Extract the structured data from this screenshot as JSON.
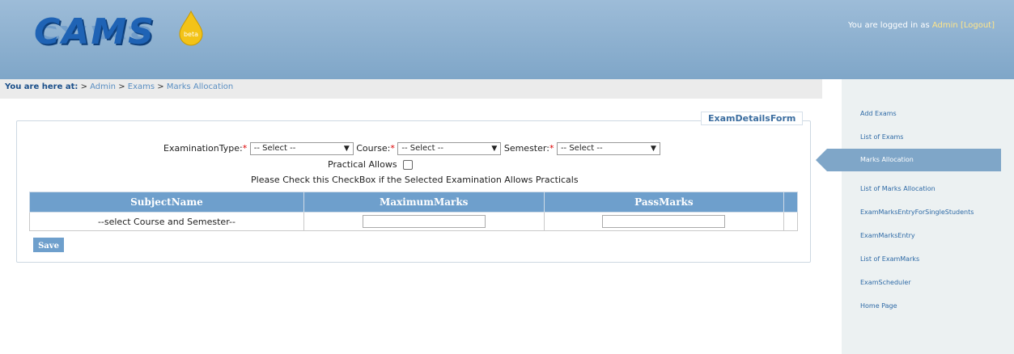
{
  "header": {
    "logo_text": "CAMS",
    "logo_badge": "beta",
    "login_prefix": "You are logged in as",
    "user": "Admin",
    "logout": "[Logout]"
  },
  "breadcrumb": {
    "lead": "You are here at:",
    "items": [
      "Admin",
      "Exams",
      "Marks Allocation"
    ]
  },
  "sidebar": {
    "items": [
      "Add Exams",
      "List of Exams",
      "Marks Allocation",
      "List of Marks Allocation",
      "ExamMarksEntryForSingleStudents",
      "ExamMarksEntry",
      "List of ExamMarks",
      "ExamScheduler",
      "Home Page"
    ],
    "active": "Marks Allocation"
  },
  "form": {
    "legend": "ExamDetailsForm",
    "exam_type_label": "ExaminationType:",
    "course_label": "Course:",
    "semester_label": "Semester:",
    "required_mark": "*",
    "select_placeholder": "-- Select --",
    "practical_label": "Practical Allows",
    "practical_note": "Please Check this CheckBox if the Selected Examination Allows Practicals",
    "table_headers": [
      "SubjectName",
      "MaximumMarks",
      "PassMarks"
    ],
    "empty_row_text": "--select Course and Semester--",
    "save_label": "Save"
  },
  "colors": {
    "header": "#7fa6c8",
    "accent": "#6e9fcc",
    "logo": "#1f63b5"
  }
}
